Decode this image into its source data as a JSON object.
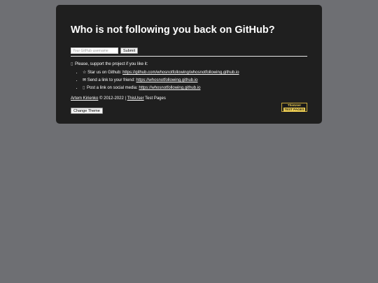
{
  "card": {
    "title": "Who is not following you back on GitHub?"
  },
  "form": {
    "username_placeholder": "Your GitHub username",
    "username_value": "",
    "submit_label": "Submit"
  },
  "support": {
    "intro": "Please, support the project if you like it:",
    "items": [
      {
        "icon": "star-icon",
        "glyph": "☆",
        "text": "Star us on Github: ",
        "link": "https://github.com/whosnotfollowing/whosnotfollowing.github.io"
      },
      {
        "icon": "mail-icon",
        "glyph": "✉",
        "text": "Send a link to your friend: ",
        "link": "https://whosnotfollowing.github.io"
      },
      {
        "icon": "share-icon",
        "glyph": "▯",
        "text": "Post a link on social media: ",
        "link": "https://whosnotfollowing.github.io"
      }
    ]
  },
  "footer": {
    "author": "Artem Kirienko",
    "copyright": " © 2012-2022 | ",
    "thisuser": "ThisUser",
    "suffix": " Test Pages",
    "theme_button": "Change Theme"
  },
  "badge": {
    "line1": "ThisUser",
    "line2": "TEST PAGES"
  },
  "colors": {
    "page_background": "#6e6f73",
    "card_background": "#1f1f1f",
    "badge_accent": "#f2d255"
  }
}
